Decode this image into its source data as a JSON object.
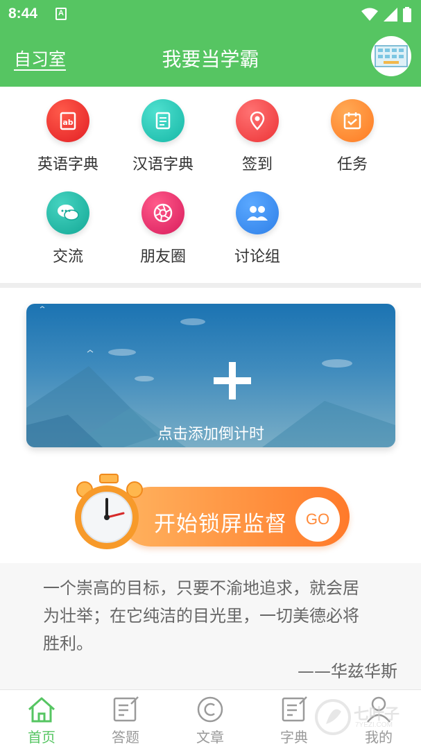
{
  "status_bar": {
    "time": "8:44",
    "app_icon_letter": "A"
  },
  "header": {
    "left_link": "自习室",
    "title": "我要当学霸",
    "avatar_icon": "classroom-avatar-icon"
  },
  "features": [
    {
      "label": "英语字典",
      "icon": "english-dictionary-icon",
      "color": "#ee2b2b"
    },
    {
      "label": "汉语字典",
      "icon": "chinese-dictionary-icon",
      "color": "#26c8b8"
    },
    {
      "label": "签到",
      "icon": "location-pin-icon",
      "color": "#f2484a"
    },
    {
      "label": "任务",
      "icon": "calendar-check-icon",
      "color": "#ff8a30"
    },
    {
      "label": "交流",
      "icon": "chat-bubbles-icon",
      "color": "#1fb5a3"
    },
    {
      "label": "朋友圈",
      "icon": "shutter-icon",
      "color": "#e6306a"
    },
    {
      "label": "讨论组",
      "icon": "group-users-icon",
      "color": "#3a8ff0"
    }
  ],
  "countdown_card": {
    "label": "点击添加倒计时",
    "icon": "plus-icon"
  },
  "lock_button": {
    "label": "开始锁屏监督",
    "go": "GO",
    "icon": "alarm-clock-icon"
  },
  "quote": {
    "text": "一个崇高的目标，只要不渝地追求，就会居为壮举；在它纯洁的目光里，一切美德必将胜利。",
    "author": "——华兹华斯"
  },
  "bottom_nav": [
    {
      "label": "首页",
      "icon": "home-icon",
      "active": true
    },
    {
      "label": "答题",
      "icon": "edit-note-icon",
      "active": false
    },
    {
      "label": "文章",
      "icon": "copyright-circle-icon",
      "active": false
    },
    {
      "label": "字典",
      "icon": "edit-note-icon",
      "active": false
    },
    {
      "label": "我的",
      "icon": "user-icon",
      "active": false
    }
  ],
  "watermark": {
    "text": "七叶子",
    "sub": "7YEZI.COM"
  },
  "colors": {
    "primary_green": "#56c562",
    "orange": "#ff8a30",
    "card_blue": "#1b73b2"
  }
}
